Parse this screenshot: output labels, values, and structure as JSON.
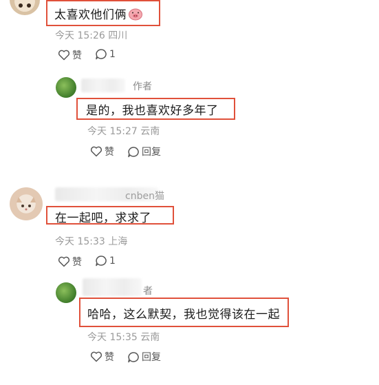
{
  "comments": [
    {
      "text": "太喜欢他们俩",
      "time": "今天 15:26",
      "location": "四川",
      "like_label": "赞",
      "reply_count": "1",
      "avatar_icon": "puppy-face-avatar",
      "emoji_icon": "pig-face-emoji-icon",
      "reply": {
        "username_fragment": "",
        "author_tag": "作者",
        "text": "是的，我也喜欢好多年了",
        "time": "今天 15:27",
        "location": "云南",
        "like_label": "赞",
        "reply_label": "回复"
      }
    },
    {
      "username_fragment": "cnben猫",
      "text": "在一起吧，求求了",
      "time": "今天 15:33",
      "location": "上海",
      "like_label": "赞",
      "reply_count": "1",
      "avatar_icon": "cat-avatar",
      "reply": {
        "author_tag": "者",
        "text": "哈哈，这么默契，我也觉得该在一起",
        "time": "今天 15:35",
        "location": "云南",
        "like_label": "赞",
        "reply_label": "回复"
      }
    }
  ],
  "colors": {
    "highlight_border": "#e0503a",
    "meta_text": "#9a9a9a"
  }
}
